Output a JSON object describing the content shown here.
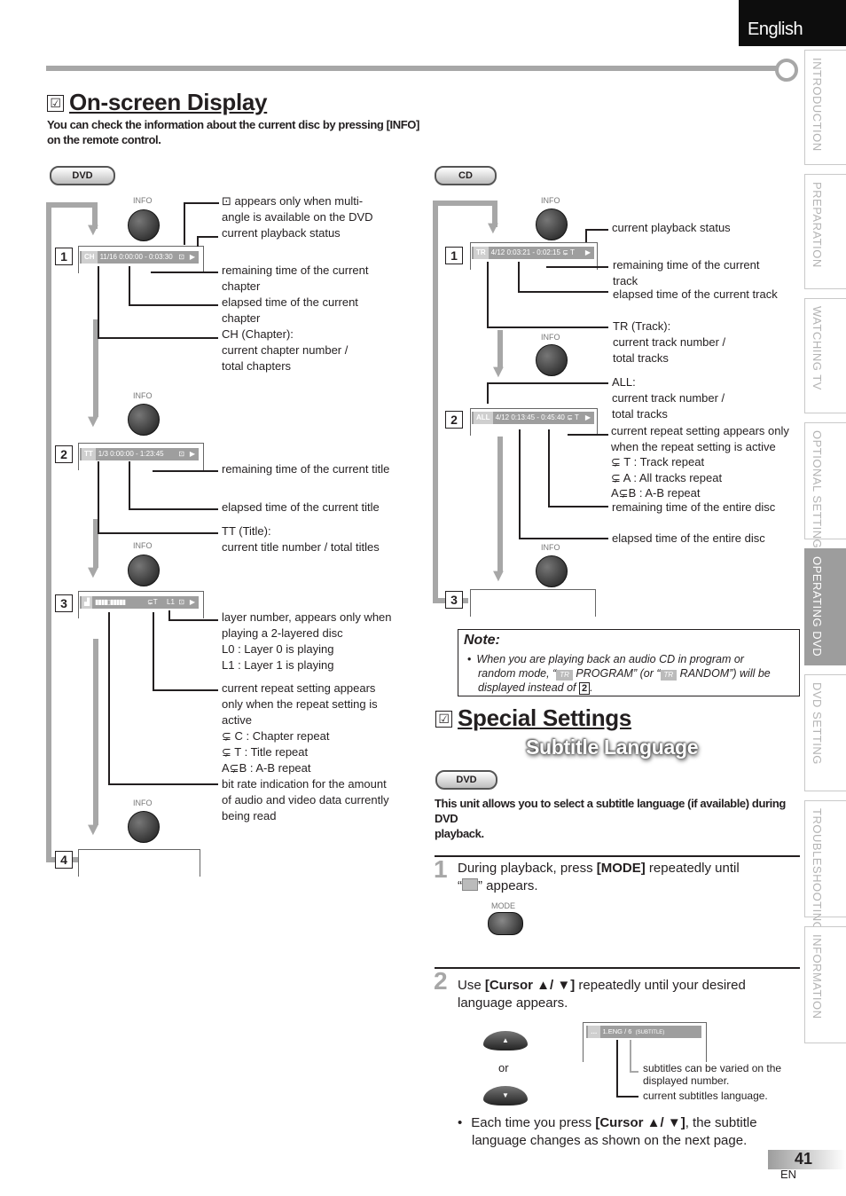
{
  "header": {
    "language_tab": "English"
  },
  "side_tabs": [
    {
      "label": "INTRODUCTION",
      "active": false
    },
    {
      "label": "PREPARATION",
      "active": false
    },
    {
      "label": "WATCHING  TV",
      "active": false
    },
    {
      "label": "OPTIONAL  SETTING",
      "active": false
    },
    {
      "label": "OPERATING  DVD",
      "active": true
    },
    {
      "label": "DVD  SETTING",
      "active": false
    },
    {
      "label": "TROUBLESHOOTING",
      "active": false
    },
    {
      "label": "INFORMATION",
      "active": false
    }
  ],
  "onscreen": {
    "check": "☑",
    "title": "On-screen Display",
    "intro_line1": "You can check the information about the current disc by pressing [INFO]",
    "intro_line2": "on the remote control."
  },
  "dvd_col": {
    "badge": "DVD",
    "info_label": "INFO",
    "step1": {
      "num": "1",
      "tag": "CH",
      "text": "11/16  0:00:00 - 0:03:30",
      "status": "▶",
      "angle": "⊡"
    },
    "step2": {
      "num": "2",
      "tag": "TT",
      "text": "1/3     0:00:00 - 1:23:45",
      "status": "▶",
      "angle": "⊡"
    },
    "step3": {
      "num": "3",
      "tag": "▟",
      "text": "▮▮▮▮▯▮▮▮▮▮",
      "repeat": "⊊T",
      "layer": "L1",
      "status": "▶",
      "angle": "⊡"
    },
    "step4": {
      "num": "4"
    },
    "labels": {
      "angle1": "  appears only when multi-",
      "angle2": "angle is available on the DVD",
      "status": "current playback status",
      "rem_chap1": "remaining time of the current",
      "rem_chap2": "chapter",
      "el_chap1": "elapsed time of the current",
      "el_chap2": "chapter",
      "ch1": "CH (Chapter):",
      "ch2": "current chapter number /",
      "ch3": "total chapters",
      "rem_title": "remaining time of the current title",
      "el_title": "elapsed time of the current title",
      "tt1": "TT (Title):",
      "tt2": "current title number / total titles",
      "layer1": "layer number, appears only when",
      "layer2": "playing a 2-layered disc",
      "layer3": "L0 :    Layer 0 is playing",
      "layer4": "L1 :    Layer 1 is playing",
      "rep1": "current repeat setting appears",
      "rep2": "only when the repeat setting is",
      "rep3": "active",
      "rep4": "⊊ C :    Chapter repeat",
      "rep5": "⊊ T :    Title repeat",
      "rep6": "A⊊B :  A-B repeat",
      "bit1": "bit rate indication for the amount",
      "bit2": "of audio and video data currently",
      "bit3": "being read"
    }
  },
  "cd_col": {
    "badge": "CD",
    "info_label": "INFO",
    "step1": {
      "num": "1",
      "tag": "TR",
      "text": "4/12  0:03:21 - 0:02:15   ⊊ T",
      "status": "▶"
    },
    "step2": {
      "num": "2",
      "tag": "ALL",
      "text": "4/12  0:13:45 - 0:45:40   ⊊ T",
      "status": "▶"
    },
    "step3": {
      "num": "3"
    },
    "labels": {
      "status": "current playback status",
      "rem_track1": "remaining time of the current",
      "rem_track2": "track",
      "el_track": "elapsed time of the current track",
      "tr1": "TR (Track):",
      "tr2": "current track number /",
      "tr3": "total tracks",
      "all1": "ALL:",
      "all2": "current track number /",
      "all3": "total tracks",
      "rep1": "current repeat setting appears only",
      "rep2": "when the repeat setting is active",
      "rep3": "⊊ T :     Track repeat",
      "rep4": "⊊ A :     All tracks repeat",
      "rep5": "A⊊B :  A-B repeat",
      "rem_disc": "remaining time of the entire disc",
      "el_disc": "elapsed time of the entire disc"
    }
  },
  "note": {
    "title": "Note:",
    "bullet": "•",
    "line1": "When you are playing back an audio CD in program or",
    "line2a": "random mode, “",
    "tag": "TR",
    "line2b": " PROGRAM” (or “",
    "line2c": " RANDOM”) will be",
    "line3": "displayed instead of ",
    "ref": "2",
    "line3end": "."
  },
  "special": {
    "check": "☑",
    "title": "Special Settings",
    "banner": "Subtitle Language",
    "badge": "DVD",
    "intro_line1": "This unit allows you to select a subtitle language (if available) during DVD",
    "intro_line2": "playback.",
    "step1": {
      "num": "1",
      "text_a": "During playback, press ",
      "key": "[MODE]",
      "text_b": " repeatedly until",
      "text_c": "“",
      "text_d": "” appears.",
      "button_label": "MODE"
    },
    "step2": {
      "num": "2",
      "text_a": "Use ",
      "key": "[Cursor ▲/ ▼]",
      "text_b": " repeatedly until your desired",
      "text_c": "language appears.",
      "or": "or",
      "osd_text": "1.ENG / 6",
      "osd_suffix": "(SUBTITLE)",
      "label_varied1": "subtitles can be varied on the",
      "label_varied2": "displayed number.",
      "label_current": "current subtitles language."
    },
    "bullet": "•",
    "tip_a": "Each time you press ",
    "tip_key": "[Cursor ▲/ ▼]",
    "tip_b": ", the subtitle",
    "tip_c": "language changes as shown on the next page."
  },
  "footer": {
    "page": "41",
    "lang": "EN"
  }
}
